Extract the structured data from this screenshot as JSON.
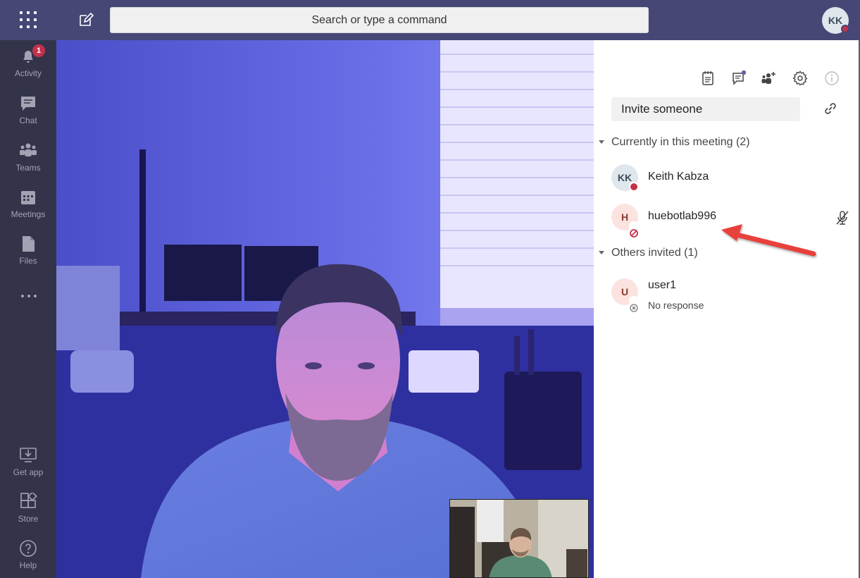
{
  "topbar": {
    "search_placeholder": "Search or type a command",
    "avatar_initials": "KK",
    "bg_color": "#464775"
  },
  "rail": {
    "items": [
      {
        "label": "Activity",
        "icon": "bell-icon",
        "badge": "1"
      },
      {
        "label": "Chat",
        "icon": "chat-icon"
      },
      {
        "label": "Teams",
        "icon": "teams-icon"
      },
      {
        "label": "Meetings",
        "icon": "calendar-icon"
      },
      {
        "label": "Files",
        "icon": "file-icon"
      },
      {
        "label": "Get app",
        "icon": "download-icon"
      },
      {
        "label": "Store",
        "icon": "store-icon"
      },
      {
        "label": "Help",
        "icon": "help-icon"
      }
    ]
  },
  "panel": {
    "invite_placeholder": "Invite someone",
    "current_section": "Currently in this meeting (2)",
    "invited_section": "Others invited (1)",
    "participants": [
      {
        "initials": "KK",
        "name": "Keith Kabza",
        "status": "busy"
      },
      {
        "initials": "H",
        "name": "huebotlab996",
        "status": "blocked",
        "muted": true
      }
    ],
    "invited": [
      {
        "initials": "U",
        "name": "user1",
        "sub": "No response"
      }
    ]
  },
  "colors": {
    "busy": "#c4314b",
    "accent": "#464775",
    "annotation_arrow": "#e8413b"
  }
}
